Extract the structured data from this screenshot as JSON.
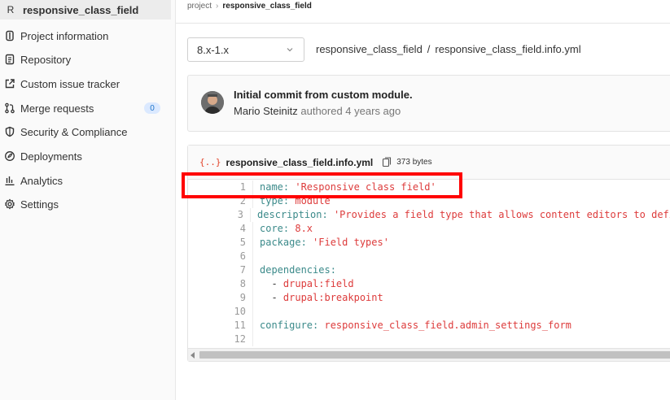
{
  "project": {
    "avatar_letter": "R",
    "name": "responsive_class_field"
  },
  "sidebar": {
    "items": [
      {
        "label": "Project information",
        "icon": "info-icon"
      },
      {
        "label": "Repository",
        "icon": "document-icon"
      },
      {
        "label": "Custom issue tracker",
        "icon": "external-link-icon"
      },
      {
        "label": "Merge requests",
        "icon": "merge-request-icon",
        "badge": "0"
      },
      {
        "label": "Security & Compliance",
        "icon": "shield-icon"
      },
      {
        "label": "Deployments",
        "icon": "rocket-icon"
      },
      {
        "label": "Analytics",
        "icon": "chart-icon"
      },
      {
        "label": "Settings",
        "icon": "gear-icon"
      }
    ]
  },
  "breadcrumb": {
    "parent": "project",
    "current": "responsive_class_field"
  },
  "branch": {
    "selected": "8.x-1.x"
  },
  "path": {
    "root": "responsive_class_field",
    "file": "responsive_class_field.info.yml"
  },
  "commit": {
    "title": "Initial commit from custom module.",
    "author": "Mario Steinitz",
    "meta": "authored 4 years ago"
  },
  "file": {
    "icon_text": "{..}",
    "name": "responsive_class_field.info.yml",
    "size": "373 bytes"
  },
  "code": {
    "lines": [
      {
        "n": "1",
        "key": "name:",
        "val": " 'Responsive class field'"
      },
      {
        "n": "2",
        "key": "type:",
        "val": " module"
      },
      {
        "n": "3",
        "key": "description:",
        "val": " 'Provides a field type that allows content editors to defi"
      },
      {
        "n": "4",
        "key": "core:",
        "val": " 8.x"
      },
      {
        "n": "5",
        "key": "package:",
        "val": " 'Field types'"
      },
      {
        "n": "6",
        "key": "",
        "val": ""
      },
      {
        "n": "7",
        "key": "dependencies:",
        "val": ""
      },
      {
        "n": "8",
        "key": "  - ",
        "val": "drupal:field"
      },
      {
        "n": "9",
        "key": "  - ",
        "val": "drupal:breakpoint"
      },
      {
        "n": "10",
        "key": "",
        "val": ""
      },
      {
        "n": "11",
        "key": "configure:",
        "val": " responsive_class_field.admin_settings_form"
      },
      {
        "n": "12",
        "key": "",
        "val": ""
      }
    ]
  },
  "colors": {
    "highlight": "#ff0000",
    "yaml_key": "#3b8a8a",
    "yaml_value": "#dd3b3b"
  }
}
